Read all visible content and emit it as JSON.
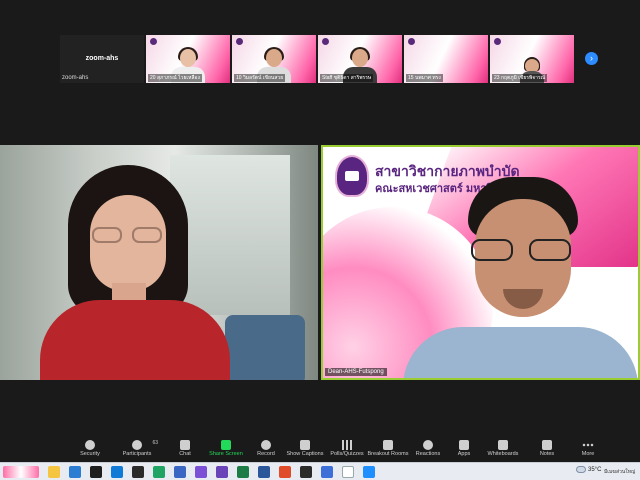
{
  "self_view": {
    "name": "zoom-ahs",
    "label": "zoom-ahs"
  },
  "thumbnails": [
    {
      "label": "20 สุภาภรณ์ ไวยเหลือง"
    },
    {
      "label": "10 วิมลรัตน์ เขียนสวย"
    },
    {
      "label": "Staff ชุติธิดา สาริพรรษ"
    },
    {
      "label": "15 นพมาศ ทรง"
    },
    {
      "label": "23 กฤตภูมิ เชียรพิจารณ์"
    }
  ],
  "strip_next": "›",
  "speaker_right": {
    "title_line1": "สาขาวิชากายภาพบำบัด",
    "title_line2": "คณะสหเวชศาสตร์ มหาวิทยาลัย",
    "name_tag": "Dean-AHS-Futspong"
  },
  "toolbar": {
    "participants_count": "63",
    "items": [
      {
        "label": "Security"
      },
      {
        "label": "Participants"
      },
      {
        "label": "Chat"
      },
      {
        "label": "Share Screen"
      },
      {
        "label": "Record"
      },
      {
        "label": "Show Captions"
      },
      {
        "label": "Polls/Quizzes"
      },
      {
        "label": "Breakout Rooms"
      },
      {
        "label": "Reactions"
      },
      {
        "label": "Apps"
      },
      {
        "label": "Whiteboards"
      },
      {
        "label": "Notes"
      },
      {
        "label": "More"
      }
    ]
  },
  "taskbar": {
    "weather_temp": "35°C",
    "weather_text": "มีเมฆส่วนใหญ่",
    "icon_colors": [
      "#f5c542",
      "#2b7cd3",
      "#1e1e1e",
      "#0f7bd6",
      "#2b2b2b",
      "#1fa463",
      "#3a66c4",
      "#7b4fd6",
      "#6a43b8",
      "#1d7b45",
      "#2b579a",
      "#e04b2a",
      "#2b2b2b",
      "#3d6fd8",
      "#ffffff",
      "#1f8fff"
    ]
  }
}
